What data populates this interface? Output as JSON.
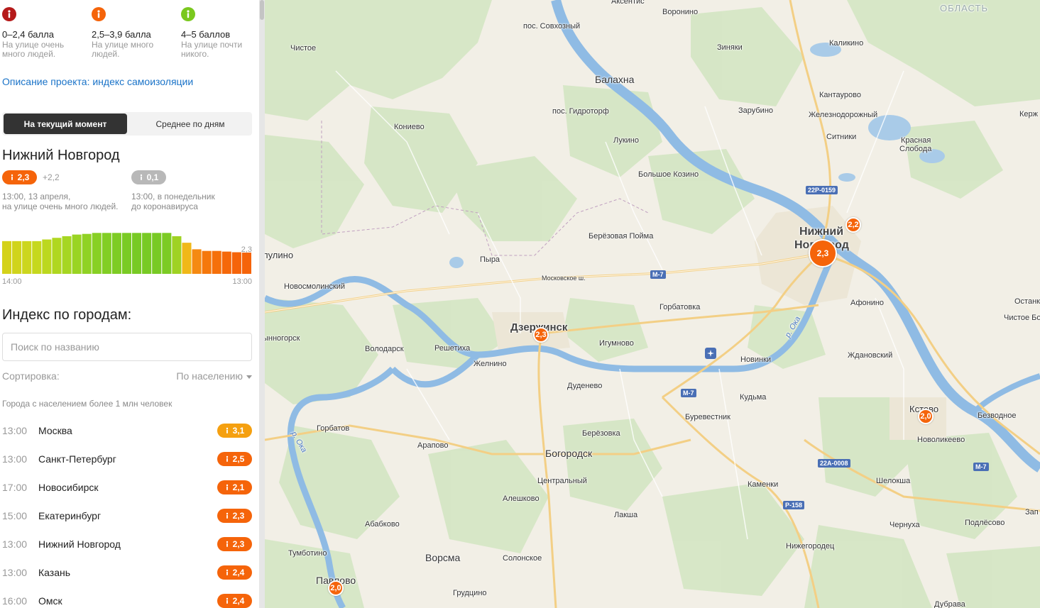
{
  "legend": [
    {
      "range": "0–2,4 балла",
      "desc": "На улице очень много людей.",
      "color": "#b51a1a"
    },
    {
      "range": "2,5–3,9 балла",
      "desc": "На улице много людей.",
      "color": "#f5640a"
    },
    {
      "range": "4–5 баллов",
      "desc": "На улице почти никого.",
      "color": "#7ac81e"
    }
  ],
  "project_link": "Описание проекта: индекс самоизоляции",
  "mode_tabs": {
    "current": "На текущий момент",
    "average": "Среднее по дням"
  },
  "city": {
    "name": "Нижний Новгород",
    "now_value": "2,3",
    "delta": "+2,2",
    "now_desc_line1": "13:00, 13 апреля,",
    "now_desc_line2": "на улице очень много людей.",
    "old_value": "0,1",
    "old_desc_line1": "13:00, в понедельник",
    "old_desc_line2": "до коронавируса"
  },
  "chart_data": {
    "type": "bar",
    "x_start_label": "14:00",
    "x_end_label": "13:00",
    "last_value_label": "2,3",
    "values": [
      1.0,
      1.0,
      1.0,
      1.0,
      1.05,
      1.1,
      1.15,
      1.2,
      1.22,
      1.25,
      1.25,
      1.25,
      1.25,
      1.25,
      1.25,
      1.25,
      1.25,
      1.15,
      0.95,
      0.75,
      0.7,
      0.7,
      0.68,
      0.66,
      0.65
    ],
    "colors": [
      "#d4d21a",
      "#d0d41c",
      "#ccd61e",
      "#c6d81e",
      "#bcd81f",
      "#b0d720",
      "#a6d622",
      "#9ad423",
      "#90d224",
      "#88d024",
      "#82ce24",
      "#7ecc24",
      "#7acb24",
      "#78ca24",
      "#78ca24",
      "#78ca24",
      "#7ccb24",
      "#9fd223",
      "#f0b818",
      "#f58a12",
      "#f5780c",
      "#f5700b",
      "#f5680a",
      "#f5640a",
      "#f5640a"
    ]
  },
  "cities_title": "Индекс по городам:",
  "search_placeholder": "Поиск по названию",
  "sort_label": "Сортировка:",
  "sort_value": "По населению",
  "group_label": "Города с населением более 1 млн человек",
  "cities": [
    {
      "time": "13:00",
      "name": "Москва",
      "value": "3,1",
      "color": "#f5a010"
    },
    {
      "time": "13:00",
      "name": "Санкт-Петербург",
      "value": "2,5",
      "color": "#f5640a"
    },
    {
      "time": "17:00",
      "name": "Новосибирск",
      "value": "2,1",
      "color": "#f5640a"
    },
    {
      "time": "15:00",
      "name": "Екатеринбург",
      "value": "2,3",
      "color": "#f5640a"
    },
    {
      "time": "13:00",
      "name": "Нижний Новгород",
      "value": "2,3",
      "color": "#f5640a"
    },
    {
      "time": "13:00",
      "name": "Казань",
      "value": "2,4",
      "color": "#f5640a"
    },
    {
      "time": "16:00",
      "name": "Омск",
      "value": "2,4",
      "color": "#f5640a"
    }
  ],
  "map": {
    "places": [
      "Аксентис",
      "Воронино",
      "пос. Совхозный",
      "Чистое",
      "Зиняки",
      "Каликино",
      "Балахна",
      "Кантаурово",
      "пос. Гидроторф",
      "Зарубино",
      "Железнодорожный",
      "Кониево",
      "Ситники",
      "Красная",
      "Слобода",
      "Лукино",
      "Большое Козино",
      "Берёзовая Пойма",
      "Нижний",
      "Новгород",
      "Пыра",
      "Московское ш.",
      "Новосмолинский",
      "Горбатовка",
      "Афонино",
      "Дзержинск",
      "Игумново",
      "Володарск",
      "Решетиха",
      "Желнино",
      "Новинки",
      "Ждановский",
      "Дуденево",
      "Кудьма",
      "Кстово",
      "Безводное",
      "Горбатов",
      "Буревестник",
      "Арапово",
      "Берёзовка",
      "Новоликеево",
      "Богородск",
      "Шелокша",
      "Центральный",
      "Каменки",
      "Алешково",
      "Лакша",
      "Абабково",
      "Чернуха",
      "Подлёсово",
      "Тумботино",
      "Нижегородец",
      "Ворсма",
      "Солонское",
      "Павлово",
      "Грудцино",
      "Дубрава",
      "Керж",
      "Останк",
      "Чистое Бо",
      "лулино",
      "ынногорск",
      "Зап"
    ],
    "region_label": "ОБЛАСТЬ",
    "rivers": [
      "р. Ока",
      "р. Ока"
    ],
    "roads": [
      "22Р-0159",
      "М-7",
      "М-7",
      "22А-0008",
      "М-7",
      "Р-158"
    ],
    "markers": [
      "2,3",
      "2,2",
      "2,3",
      "2,0",
      "2,0"
    ]
  }
}
